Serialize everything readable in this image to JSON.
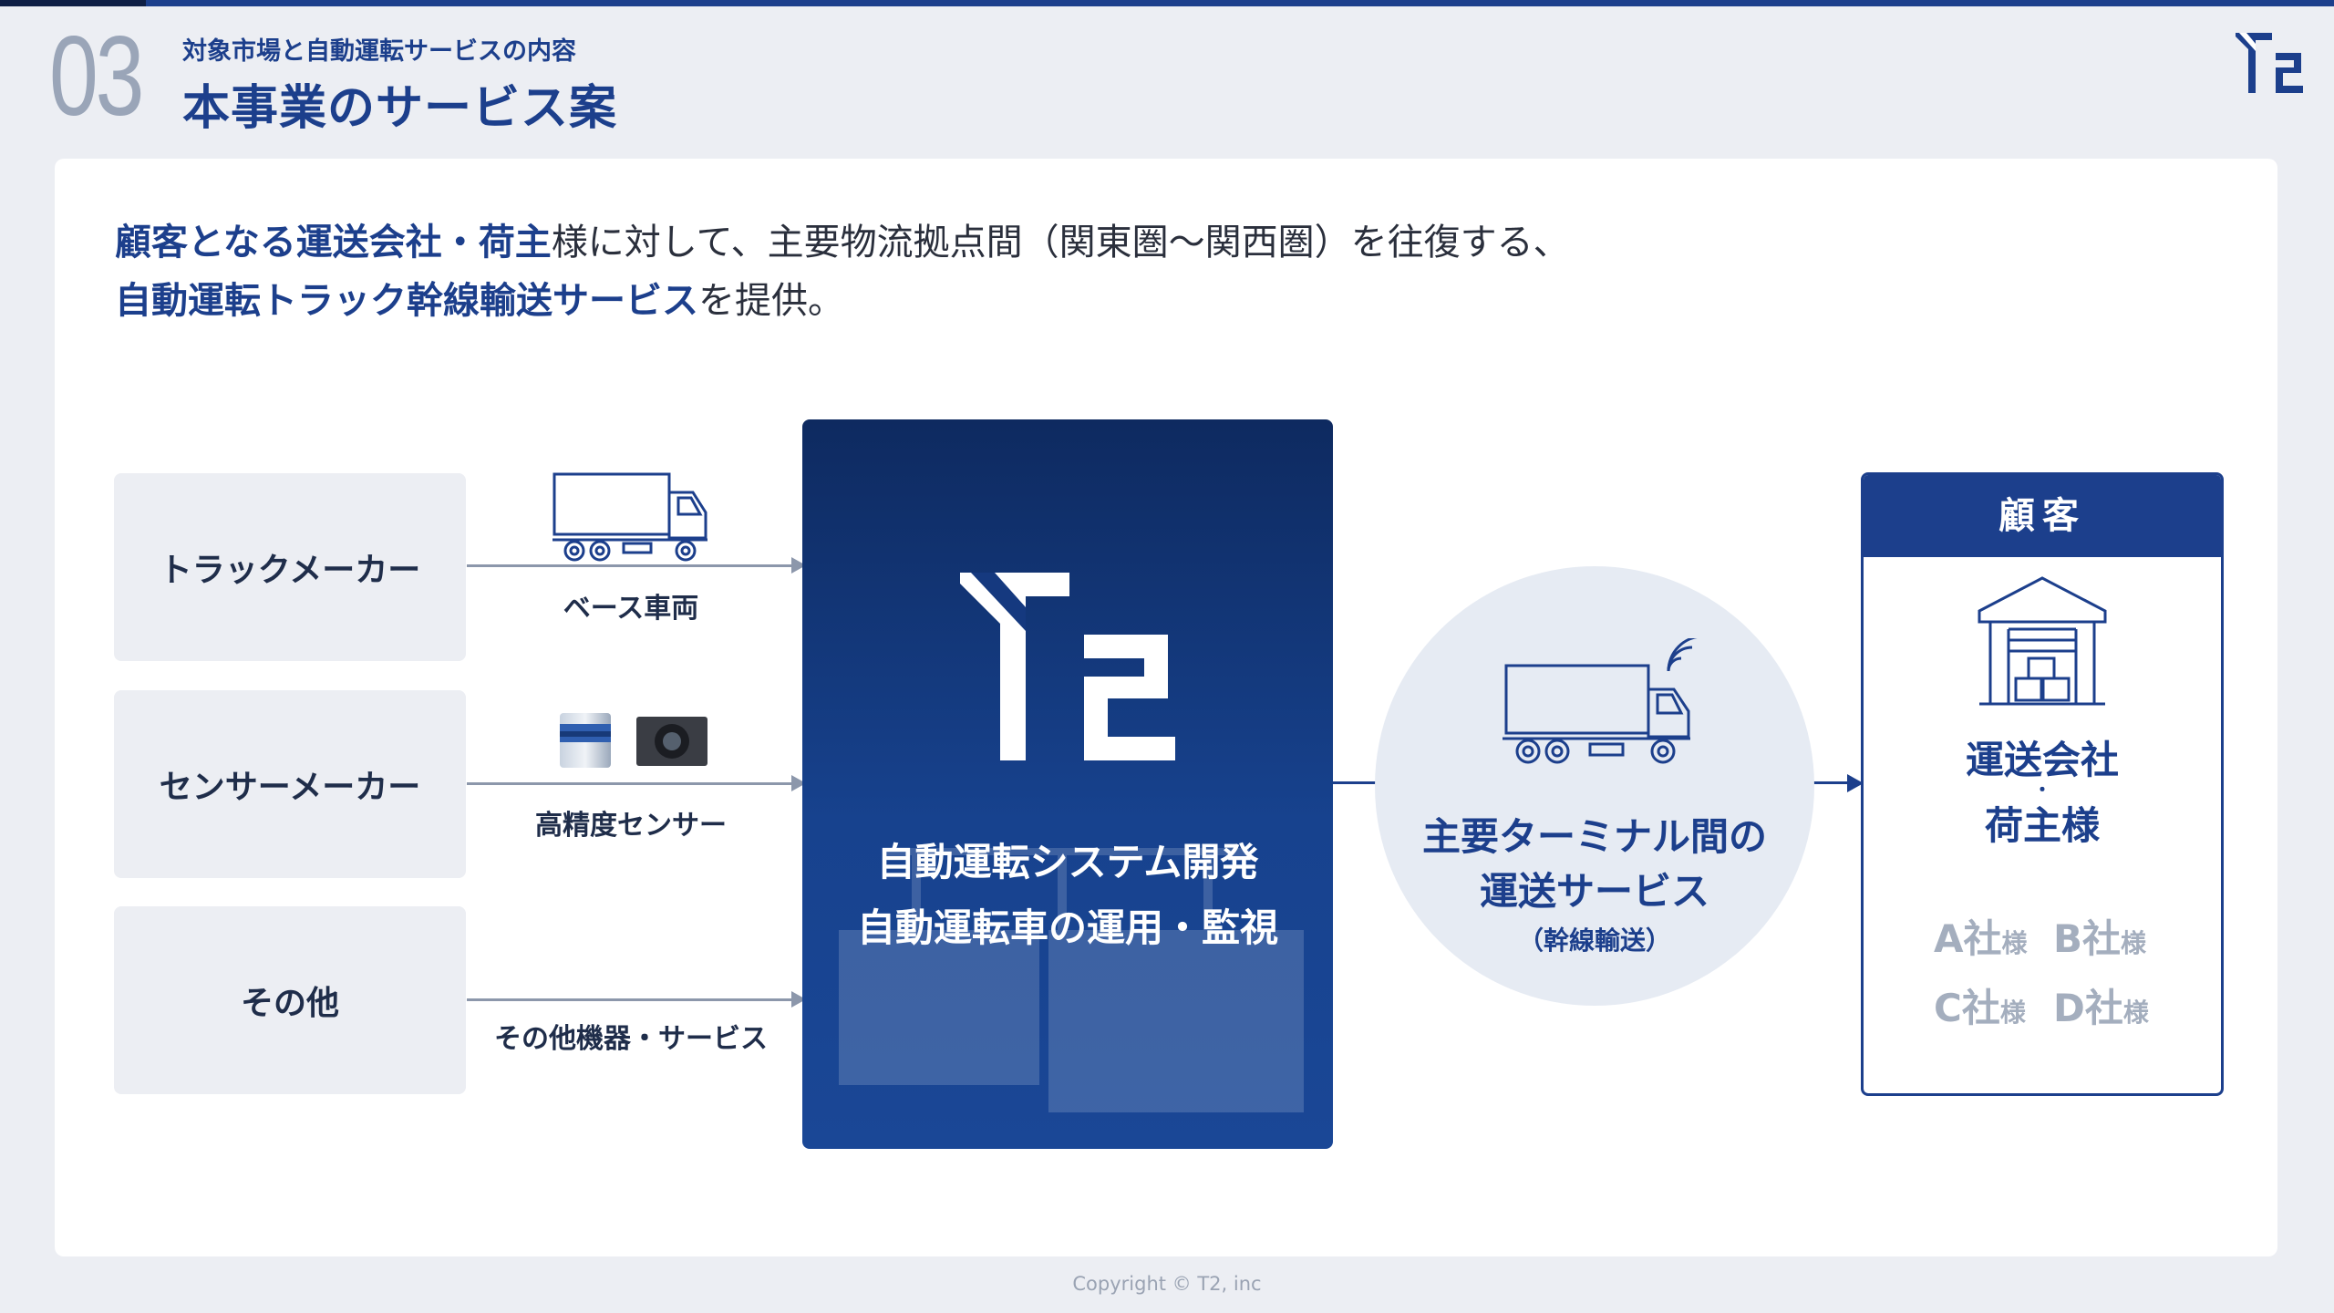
{
  "header": {
    "section_number": "03",
    "subtitle": "対象市場と自動運転サービスの内容",
    "title": "本事業のサービス案"
  },
  "intro": {
    "line1_highlight": "顧客となる運送会社・荷主",
    "line1_rest": "様に対して、主要物流拠点間（関東圏〜関西圏）を往復する、",
    "line2_highlight": "自動運転トラック幹線輸送サービス",
    "line2_rest": "を提供。"
  },
  "suppliers": [
    {
      "name": "トラックメーカー",
      "provides": "ベース車両",
      "icon": "truck-icon"
    },
    {
      "name": "センサーメーカー",
      "provides": "高精度センサー",
      "icon": "sensor-icons"
    },
    {
      "name": "その他",
      "provides": "その他機器・サービス",
      "icon": ""
    }
  ],
  "center": {
    "logo": "T2",
    "line1": "自動運転システム開発",
    "line2": "自動運転車の運用・監視"
  },
  "service": {
    "line1": "主要ターミナル間の",
    "line2": "運送サービス",
    "line3": "（幹線輸送）",
    "icon": "autonomous-truck-icon"
  },
  "customer": {
    "header": "顧客",
    "line1": "運送会社",
    "dot": "・",
    "line2": "荷主様",
    "icon": "warehouse-icon",
    "companies": [
      {
        "name": "A社",
        "suffix": "様"
      },
      {
        "name": "B社",
        "suffix": "様"
      },
      {
        "name": "C社",
        "suffix": "様"
      },
      {
        "name": "D社",
        "suffix": "様"
      }
    ]
  },
  "colors": {
    "brand": "#1c3f8c",
    "muted": "#9aa5b8",
    "box_bg": "#eceef3"
  },
  "footer": "Copyright © T2, inc"
}
